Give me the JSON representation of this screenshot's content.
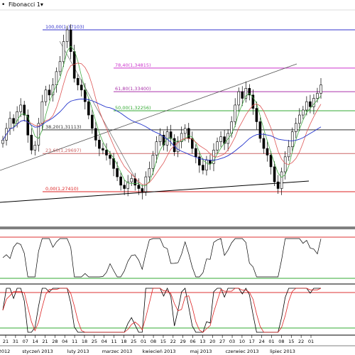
{
  "window": {
    "indicator_label": "Fibonacci 1",
    "menu_marker": "▾",
    "icon": "dot-marker-icon"
  },
  "colors": {
    "background": "#ffffff",
    "fib_100": "#3333cc",
    "fib_786": "#cc33cc",
    "fib_618": "#aa33aa",
    "fib_50": "#33aa33",
    "fib_382": "#333333",
    "fib_236": "#cc6666",
    "fib_0": "#dd2222",
    "ma_blue": "#2233cc",
    "ma_red": "#dd5555",
    "ma_green": "#44aa44",
    "trendline": "#555555",
    "osc_black": "#000000",
    "osc_red": "#dd2222",
    "osc_upper": "#dd3333",
    "osc_lower": "#33aa33",
    "candle_up": "#ffffff",
    "candle_down": "#000000"
  },
  "chart_data": {
    "type": "candlestick",
    "title": "",
    "fib_levels": [
      {
        "label": "100,00(1,37103)",
        "level": 100.0,
        "price": 1.37103
      },
      {
        "label": "78,40(1,34815)",
        "level": 78.4,
        "price": 1.34815
      },
      {
        "label": "61,80(1,33400)",
        "level": 61.8,
        "price": 1.334
      },
      {
        "label": "50,00(1,32256)",
        "level": 50.0,
        "price": 1.32256
      },
      {
        "label": "38,20(1,31113)",
        "level": 38.2,
        "price": 1.31113
      },
      {
        "label": "23,60(1,29697)",
        "level": 23.6,
        "price": 1.29697
      },
      {
        "label": "0,00(1,27410)",
        "level": 0.0,
        "price": 1.2741
      }
    ],
    "x_ticks": [
      "21",
      "31",
      "07",
      "14",
      "21",
      "28",
      "04",
      "11",
      "18",
      "25",
      "04",
      "11",
      "18",
      "25",
      "01",
      "08",
      "15",
      "22",
      "29",
      "06",
      "13",
      "20",
      "27",
      "03",
      "10",
      "17",
      "24",
      "01",
      "08",
      "15",
      "22",
      "01"
    ],
    "x_month_labels": [
      "2012",
      "styczeń 2013",
      "luty 2013",
      "marzec 2013",
      "kwiecień 2013",
      "maj 2013",
      "czerwiec 2013",
      "lipiec 2013"
    ],
    "close_series": [
      1.305,
      1.312,
      1.318,
      1.315,
      1.322,
      1.326,
      1.32,
      1.308,
      1.299,
      1.302,
      1.315,
      1.328,
      1.335,
      1.332,
      1.338,
      1.346,
      1.352,
      1.364,
      1.371,
      1.358,
      1.342,
      1.338,
      1.335,
      1.328,
      1.32,
      1.312,
      1.305,
      1.3,
      1.299,
      1.296,
      1.294,
      1.288,
      1.283,
      1.278,
      1.276,
      1.28,
      1.282,
      1.278,
      1.276,
      1.2741,
      1.283,
      1.288,
      1.296,
      1.304,
      1.308,
      1.302,
      1.31,
      1.306,
      1.298,
      1.304,
      1.309,
      1.312,
      1.306,
      1.3,
      1.295,
      1.29,
      1.287,
      1.293,
      1.291,
      1.299,
      1.304,
      1.307,
      1.303,
      1.309,
      1.316,
      1.326,
      1.334,
      1.33,
      1.336,
      1.332,
      1.324,
      1.316,
      1.306,
      1.3,
      1.296,
      1.289,
      1.28,
      1.276,
      1.286,
      1.295,
      1.301,
      1.31,
      1.315,
      1.32,
      1.323,
      1.328,
      1.325,
      1.33,
      1.333,
      1.338
    ],
    "ylim": [
      1.265,
      1.38
    ]
  }
}
